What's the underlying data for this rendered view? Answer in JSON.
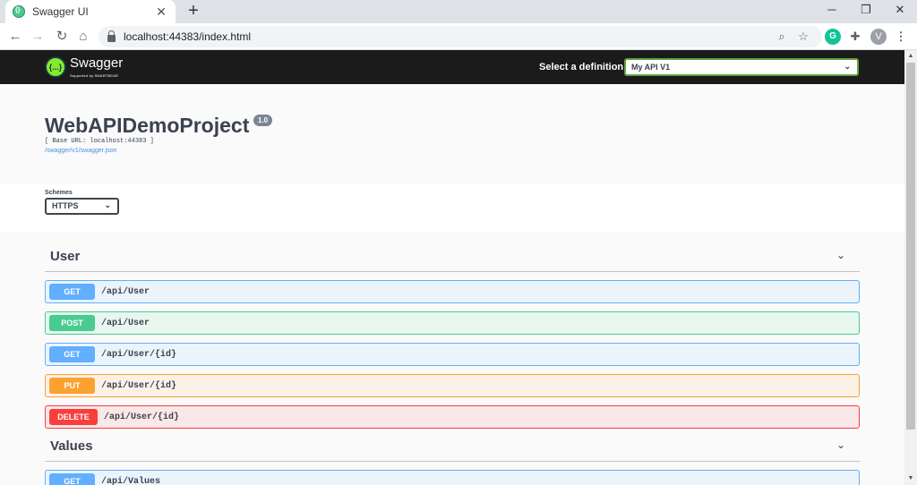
{
  "browser": {
    "tab_title": "Swagger UI",
    "tab_close": "✕",
    "new_tab": "+",
    "url": "localhost:44383/index.html",
    "avatar_letter": "V",
    "grammarly_letter": "G"
  },
  "swagger": {
    "logo_text": "Swagger",
    "logo_sub": "Supported by SMARTBEAR",
    "logo_glyph": "{...}",
    "definition_label": "Select a definition",
    "definition_value": "My API V1",
    "title": "WebAPIDemoProject",
    "version": "1.0",
    "base_url": "[ Base URL: localhost:44383 ]",
    "spec_link": "/swagger/v1/swagger.json",
    "schemes_label": "Schemes",
    "scheme_value": "HTTPS"
  },
  "tags": [
    {
      "name": "User",
      "operations": [
        {
          "method": "GET",
          "path": "/api/User"
        },
        {
          "method": "POST",
          "path": "/api/User"
        },
        {
          "method": "GET",
          "path": "/api/User/{id}"
        },
        {
          "method": "PUT",
          "path": "/api/User/{id}"
        },
        {
          "method": "DELETE",
          "path": "/api/User/{id}"
        }
      ]
    },
    {
      "name": "Values",
      "operations": [
        {
          "method": "GET",
          "path": "/api/Values"
        }
      ]
    }
  ],
  "colors": {
    "get": "#61affe",
    "post": "#49cc90",
    "put": "#fca130",
    "delete": "#f93e3e",
    "get_bg": "#ebf3fb",
    "post_bg": "#e8f6f0",
    "put_bg": "#fbf1e6",
    "delete_bg": "#fae7e7",
    "topbar": "#1b1b1b",
    "accent_green": "#85ea2d"
  }
}
